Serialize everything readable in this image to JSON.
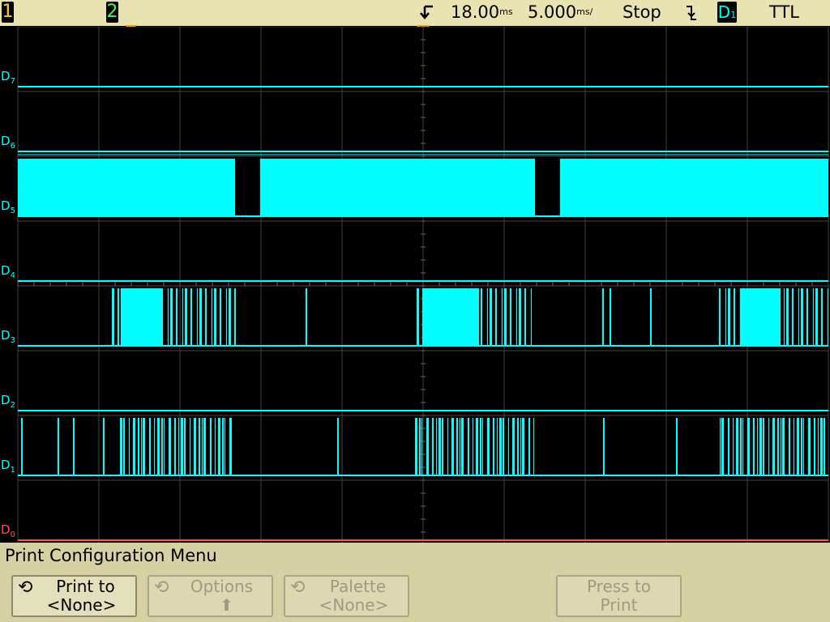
{
  "topbar": {
    "channel1": "1",
    "channel2": "2",
    "delay": "18.00",
    "delay_unit": "ms",
    "timebase": "5.000",
    "timebase_unit": "ms/",
    "run_state": "Stop",
    "trigger_slope_icon": "falling-edge-icon",
    "trigger_source_letter": "D",
    "trigger_source_sub": "1",
    "threshold": "TTL"
  },
  "colors": {
    "digital": "#00ffff",
    "d0": "#ff5050",
    "ch1": "#ffd000",
    "ch2": "#40ff40",
    "bar": "#e8e3b0",
    "menu": "#d6d1a3"
  },
  "channels": [
    {
      "letter": "D",
      "sub": "7"
    },
    {
      "letter": "D",
      "sub": "6"
    },
    {
      "letter": "D",
      "sub": "5"
    },
    {
      "letter": "D",
      "sub": "4"
    },
    {
      "letter": "D",
      "sub": "3"
    },
    {
      "letter": "D",
      "sub": "2"
    },
    {
      "letter": "D",
      "sub": "1"
    },
    {
      "letter": "D",
      "sub": "0"
    }
  ],
  "menu": {
    "title": "Print Configuration Menu",
    "softkeys": [
      {
        "line1": "Print to",
        "line2": "<None>",
        "enabled": true
      },
      {
        "line1": "Options",
        "line2": "",
        "enabled": false
      },
      {
        "line1": "Palette",
        "line2": "<None>",
        "enabled": false
      },
      {
        "line1": "Press to",
        "line2": "Print",
        "enabled": false
      }
    ]
  }
}
